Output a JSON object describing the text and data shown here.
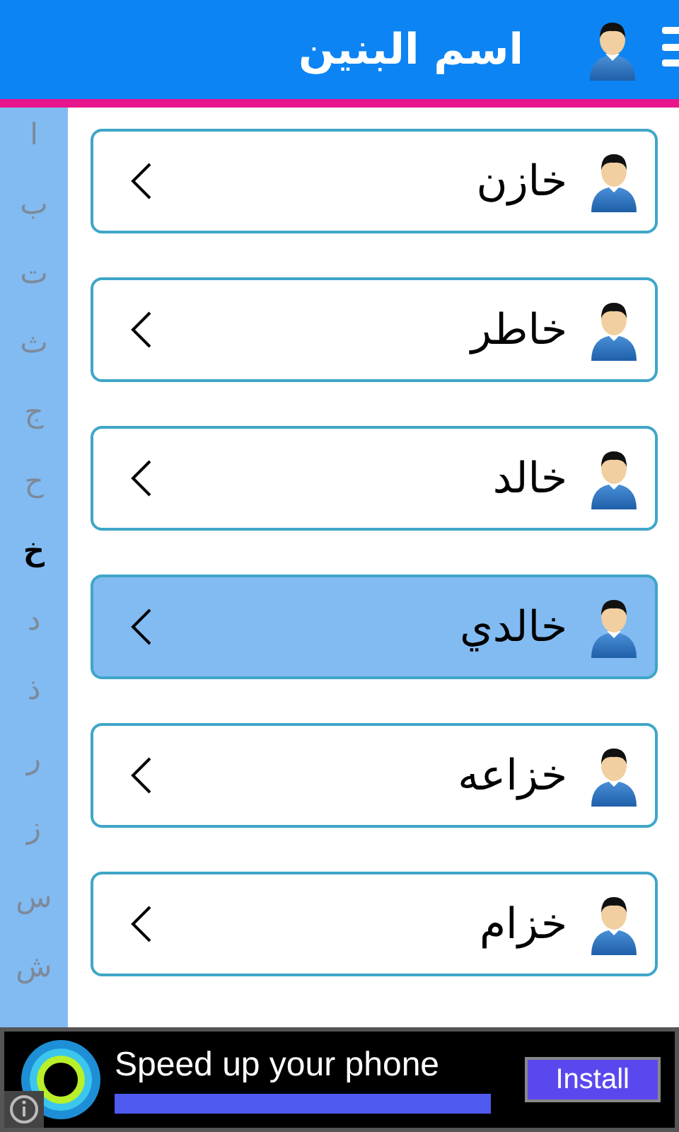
{
  "header": {
    "title": "اسم البنين"
  },
  "index_letters": [
    {
      "letter": "ا",
      "selected": false
    },
    {
      "letter": "ب",
      "selected": false
    },
    {
      "letter": "ت",
      "selected": false
    },
    {
      "letter": "ث",
      "selected": false
    },
    {
      "letter": "ج",
      "selected": false
    },
    {
      "letter": "ح",
      "selected": false
    },
    {
      "letter": "خ",
      "selected": true
    },
    {
      "letter": "د",
      "selected": false
    },
    {
      "letter": "ذ",
      "selected": false
    },
    {
      "letter": "ر",
      "selected": false
    },
    {
      "letter": "ز",
      "selected": false
    },
    {
      "letter": "س",
      "selected": false
    },
    {
      "letter": "ش",
      "selected": false
    }
  ],
  "names": [
    {
      "name": "خازن",
      "selected": false
    },
    {
      "name": "خاطر",
      "selected": false
    },
    {
      "name": "خالد",
      "selected": false
    },
    {
      "name": "خالدي",
      "selected": true
    },
    {
      "name": "خزاعه",
      "selected": false
    },
    {
      "name": "خزام",
      "selected": false
    }
  ],
  "ad": {
    "headline": "Speed up your phone",
    "button": "Install"
  }
}
